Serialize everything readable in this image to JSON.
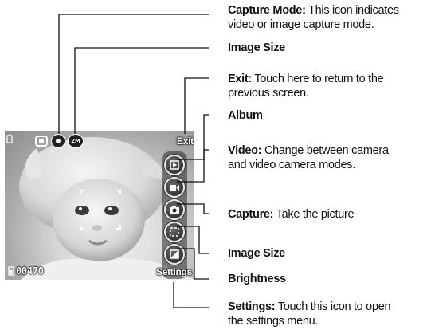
{
  "screen": {
    "exit_label": "Exit",
    "counter": "00470",
    "settings_label": "Settings",
    "image_size_badge": "2M"
  },
  "callouts": [
    {
      "title": "Capture Mode:",
      "text": "This icon indicates",
      "text2": "video or image capture mode."
    },
    {
      "title": "Image Size",
      "text": "",
      "text2": ""
    },
    {
      "title": "Exit:",
      "text": "Touch here to return to the",
      "text2": "previous screen."
    },
    {
      "title": "Album",
      "text": "",
      "text2": ""
    },
    {
      "title": "Video:",
      "text": "Change between camera",
      "text2": "and video camera modes."
    },
    {
      "title": "Capture:",
      "text": "Take the picture",
      "text2": ""
    },
    {
      "title": "Image Size",
      "text": "",
      "text2": ""
    },
    {
      "title": "Brightness",
      "text": "",
      "text2": ""
    },
    {
      "title": "Settings:",
      "text": "Touch this icon to open",
      "text2": "the settings menu."
    }
  ],
  "icons": [
    "capture-mode-icon",
    "image-size-icon",
    "album-icon",
    "video-icon",
    "capture-icon",
    "image-size-button-icon",
    "brightness-icon",
    "battery-icon",
    "memory-icon"
  ],
  "colors": {
    "leader_line": "#111111",
    "panel_button": "#2a2a2a"
  }
}
